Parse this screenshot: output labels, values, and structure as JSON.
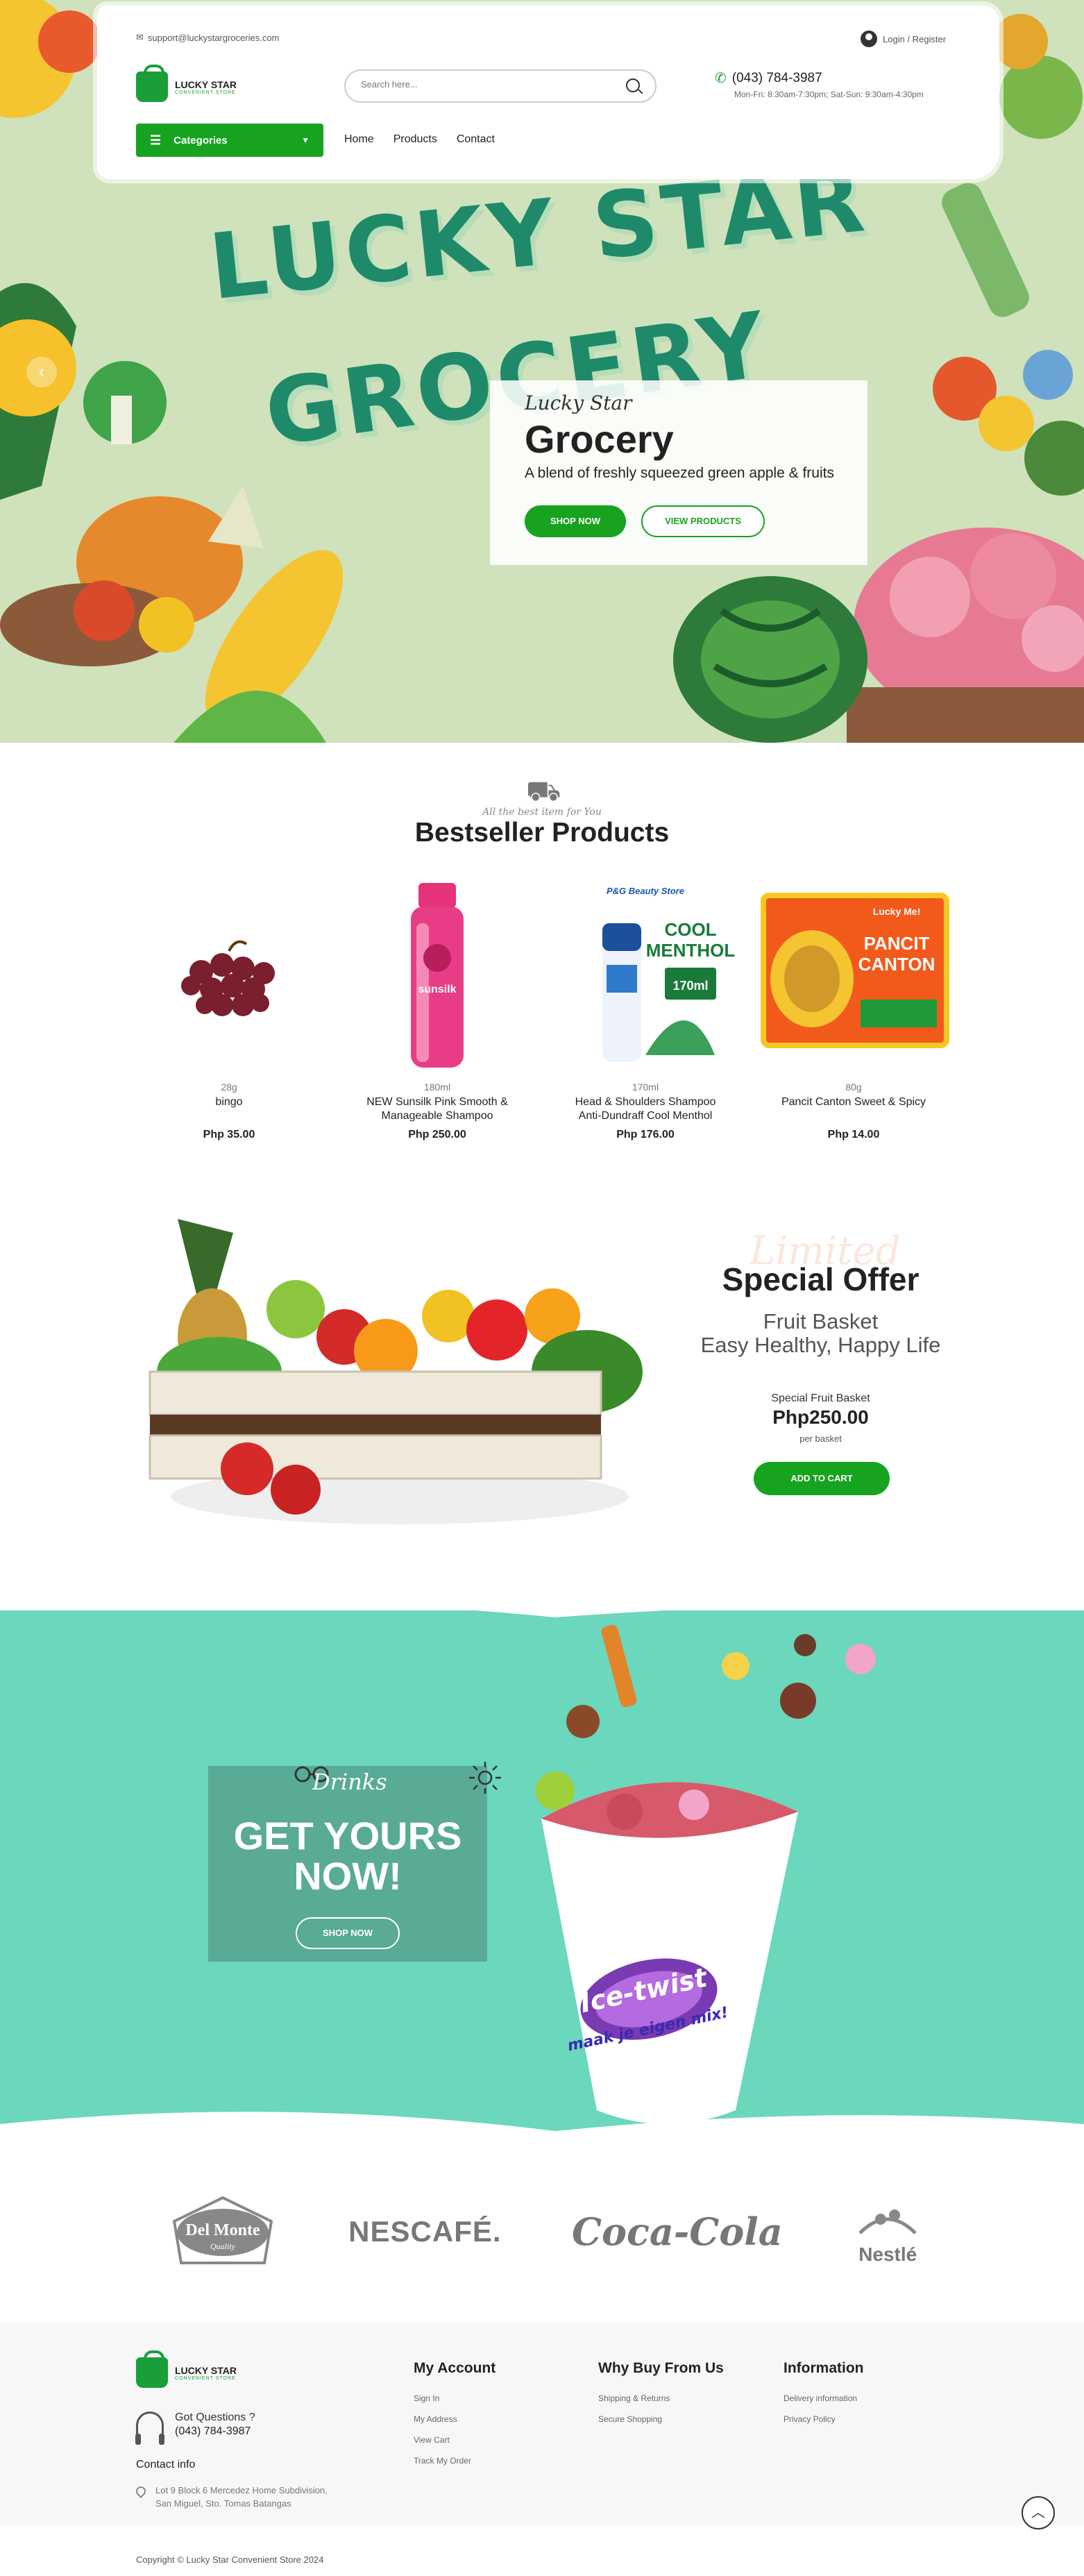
{
  "topbar": {
    "email": "support@luckystargroceries.com",
    "login": "Login / Register"
  },
  "brand": {
    "name": "LUCKY STAR",
    "tagline": "CONVENIENT STORE"
  },
  "search": {
    "placeholder": "Search here..."
  },
  "contact": {
    "phone": "(043) 784-3987",
    "hours": "Mon-Fri: 8:30am-7:30pm; Sat-Sun: 9:30am-4:30pm"
  },
  "nav": {
    "categories": "Categories",
    "items": [
      "Home",
      "Products",
      "Contact"
    ]
  },
  "hero": {
    "art_line1": "LUCKY STAR",
    "art_line2": "GROCERY",
    "eyebrow": "Lucky Star",
    "title": "Grocery",
    "description": "A blend of freshly squeezed green apple & fruits",
    "shop_now": "SHOP NOW",
    "view_products": "VIEW PRODUCTS",
    "prev_arrow": "‹"
  },
  "bestseller": {
    "subtitle": "All the best item for You",
    "title": "Bestseller Products",
    "products": [
      {
        "size": "28g",
        "name": "bingo",
        "price": "Php 35.00"
      },
      {
        "size": "180ml",
        "name": "NEW Sunsilk Pink Smooth & Manageable Shampoo",
        "price": "Php 250.00",
        "label": "sunsilk"
      },
      {
        "size": "170ml",
        "name": "Head & Shoulders Shampoo Anti-Dundraff Cool Menthol",
        "price": "Php 176.00",
        "label_top": "P&G Beauty Store",
        "label_1": "COOL",
        "label_2": "MENTHOL",
        "label_3": "170ml"
      },
      {
        "size": "80g",
        "name": "Pancit Canton Sweet & Spicy",
        "price": "Php 14.00",
        "label_1": "Lucky Me!",
        "label_2": "PANCIT",
        "label_3": "CANTON"
      }
    ]
  },
  "offer": {
    "script": "Limited",
    "title": "Special Offer",
    "line1": "Fruit Basket",
    "line2": "Easy Healthy, Happy Life",
    "label": "Special Fruit Basket",
    "price": "Php250.00",
    "unit": "per basket",
    "button": "ADD TO CART"
  },
  "drinks": {
    "script": "Drinks",
    "headline_1": "GET YOURS",
    "headline_2": "NOW!",
    "button": "SHOP NOW",
    "cup_brand": "Ice-twist",
    "cup_tagline": "maak je eigen mix!"
  },
  "brands": [
    "Del Monte",
    "NESCAFÉ.",
    "Coca-Cola",
    "Nestlé"
  ],
  "brand_quality": "Quality",
  "footer": {
    "questions": "Got Questions ?",
    "phone": "(043) 784-3987",
    "contact_title": "Contact info",
    "address_1": "Lot 9 Block 6 Mercedez Home Subdivision,",
    "address_2": "San Miguel, Sto. Tomas Batangas",
    "col1": {
      "title": "My Account",
      "links": [
        "Sign In",
        "My Address",
        "View Cart",
        "Track My Order"
      ]
    },
    "col2": {
      "title": "Why Buy From Us",
      "links": [
        "Shipping & Returns",
        "Secure Shopping"
      ]
    },
    "col3": {
      "title": "Information",
      "links": [
        "Delivery information",
        "Privacy Policy"
      ]
    },
    "copyright": "Copyright © Lucky Star Convenient Store 2024"
  },
  "colors": {
    "primary_green": "#17a31f",
    "hero_bg": "#cfe2bb",
    "teal": "#6bd7bd",
    "teal_box": "#59ab95"
  }
}
